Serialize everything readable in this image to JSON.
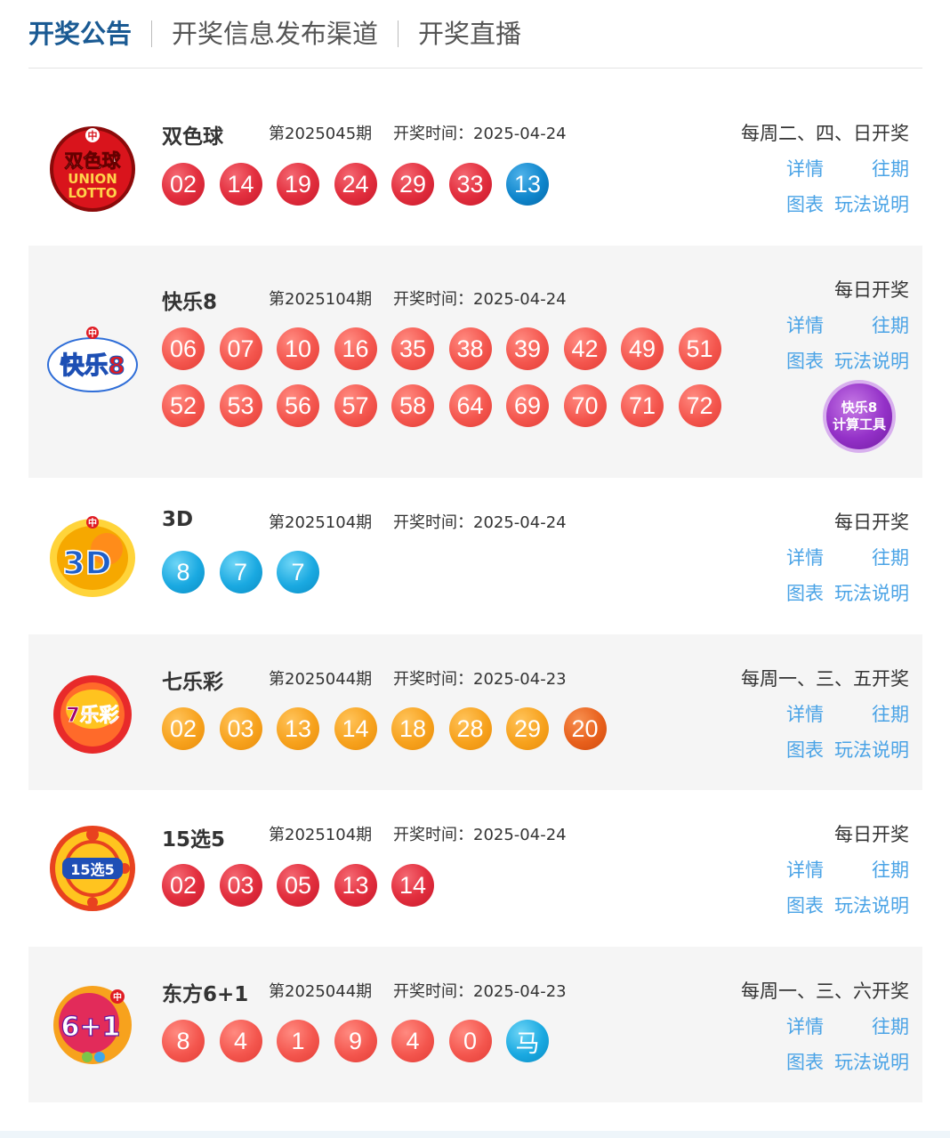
{
  "tabs": [
    {
      "label": "开奖公告",
      "active": true
    },
    {
      "label": "开奖信息发布渠道",
      "active": false
    },
    {
      "label": "开奖直播",
      "active": false
    }
  ],
  "links": {
    "detail": "详情",
    "history": "往期",
    "chart": "图表",
    "rules": "玩法说明"
  },
  "lotteries": [
    {
      "name": "双色球",
      "issue": "第2025045期",
      "draw_time": "开奖时间：2025-04-24",
      "schedule": "每周二、四、日开奖",
      "logo_text": [
        "双色球",
        "UNION",
        "LOTTO"
      ],
      "balls": [
        {
          "n": "02",
          "c": "red"
        },
        {
          "n": "14",
          "c": "red"
        },
        {
          "n": "19",
          "c": "red"
        },
        {
          "n": "24",
          "c": "red"
        },
        {
          "n": "29",
          "c": "red"
        },
        {
          "n": "33",
          "c": "red"
        },
        {
          "n": "13",
          "c": "blue"
        }
      ]
    },
    {
      "name": "快乐8",
      "issue": "第2025104期",
      "draw_time": "开奖时间：2025-04-24",
      "schedule": "每日开奖",
      "logo_text": [
        "快乐8"
      ],
      "calc_tool": [
        "快乐8",
        "计算工具"
      ],
      "balls": [
        {
          "n": "06",
          "c": "coral"
        },
        {
          "n": "07",
          "c": "coral"
        },
        {
          "n": "10",
          "c": "coral"
        },
        {
          "n": "16",
          "c": "coral"
        },
        {
          "n": "35",
          "c": "coral"
        },
        {
          "n": "38",
          "c": "coral"
        },
        {
          "n": "39",
          "c": "coral"
        },
        {
          "n": "42",
          "c": "coral"
        },
        {
          "n": "49",
          "c": "coral"
        },
        {
          "n": "51",
          "c": "coral"
        },
        {
          "n": "52",
          "c": "coral"
        },
        {
          "n": "53",
          "c": "coral"
        },
        {
          "n": "56",
          "c": "coral"
        },
        {
          "n": "57",
          "c": "coral"
        },
        {
          "n": "58",
          "c": "coral"
        },
        {
          "n": "64",
          "c": "coral"
        },
        {
          "n": "69",
          "c": "coral"
        },
        {
          "n": "70",
          "c": "coral"
        },
        {
          "n": "71",
          "c": "coral"
        },
        {
          "n": "72",
          "c": "coral"
        }
      ]
    },
    {
      "name": "3D",
      "issue": "第2025104期",
      "draw_time": "开奖时间：2025-04-24",
      "schedule": "每日开奖",
      "logo_text": [
        "3D"
      ],
      "balls": [
        {
          "n": "8",
          "c": "cyan"
        },
        {
          "n": "7",
          "c": "cyan"
        },
        {
          "n": "7",
          "c": "cyan"
        }
      ]
    },
    {
      "name": "七乐彩",
      "issue": "第2025044期",
      "draw_time": "开奖时间：2025-04-23",
      "schedule": "每周一、三、五开奖",
      "logo_text": [
        "7乐彩"
      ],
      "balls": [
        {
          "n": "02",
          "c": "orange"
        },
        {
          "n": "03",
          "c": "orange"
        },
        {
          "n": "13",
          "c": "orange"
        },
        {
          "n": "14",
          "c": "orange"
        },
        {
          "n": "18",
          "c": "orange"
        },
        {
          "n": "28",
          "c": "orange"
        },
        {
          "n": "29",
          "c": "orange"
        },
        {
          "n": "20",
          "c": "dorange"
        }
      ]
    },
    {
      "name": "15选5",
      "issue": "第2025104期",
      "draw_time": "开奖时间：2025-04-24",
      "schedule": "每日开奖",
      "logo_text": [
        "15选5"
      ],
      "balls": [
        {
          "n": "02",
          "c": "red"
        },
        {
          "n": "03",
          "c": "red"
        },
        {
          "n": "05",
          "c": "red"
        },
        {
          "n": "13",
          "c": "red"
        },
        {
          "n": "14",
          "c": "red"
        }
      ]
    },
    {
      "name": "东方6+1",
      "issue": "第2025044期",
      "draw_time": "开奖时间：2025-04-23",
      "schedule": "每周一、三、六开奖",
      "logo_text": [
        "6+1"
      ],
      "balls": [
        {
          "n": "8",
          "c": "coral"
        },
        {
          "n": "4",
          "c": "coral"
        },
        {
          "n": "1",
          "c": "coral"
        },
        {
          "n": "9",
          "c": "coral"
        },
        {
          "n": "4",
          "c": "coral"
        },
        {
          "n": "0",
          "c": "coral"
        },
        {
          "n": "马",
          "c": "cyan"
        }
      ]
    }
  ]
}
